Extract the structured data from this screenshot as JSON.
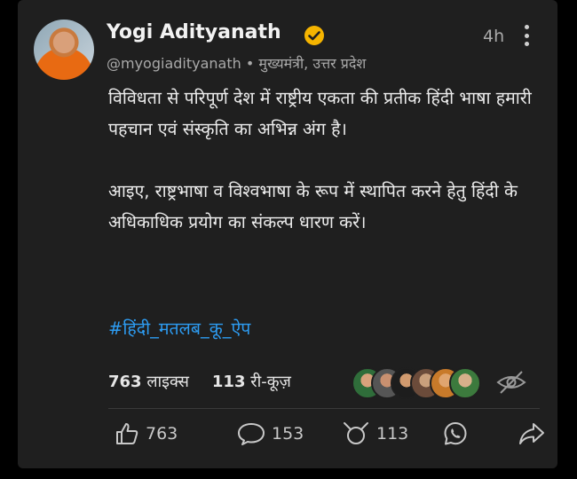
{
  "post": {
    "author_name": "Yogi Adityanath",
    "handle": "@myogiadityanath",
    "bullet": "•",
    "designation": "मुख्यमंत्री, उत्तर प्रदेश",
    "time": "4h",
    "paragraphs": [
      "विविधता से परिपूर्ण देश में राष्ट्रीय एकता की प्रतीक हिंदी भाषा हमारी पहचान एवं संस्कृति का अभिन्न अंग है।",
      "आइए, राष्ट्रभाषा व विश्वभाषा के रूप में स्थापित करने हेतु हिंदी के अधिकाधिक प्रयोग का संकल्प धारण करें।"
    ],
    "hashtag": "#हिंदी_मतलब_कू_ऐप"
  },
  "stats": {
    "likes_count": "763",
    "likes_label": "लाइक्स",
    "rekoos_count": "113",
    "rekoos_label": "री-कूज़"
  },
  "actions": {
    "like_count": "763",
    "comment_count": "153",
    "rekoo_count": "113"
  },
  "icons": {
    "verified": "verified-badge-icon",
    "more": "more-vertical-icon",
    "hide": "eye-off-icon",
    "like": "thumbs-up-icon",
    "comment": "comment-icon",
    "rekoo": "rekoo-icon",
    "whatsapp": "whatsapp-icon",
    "share": "share-icon"
  },
  "colors": {
    "background": "#1f1f1f",
    "hashtag": "#2d9cf2",
    "verified": "#f5b400"
  }
}
